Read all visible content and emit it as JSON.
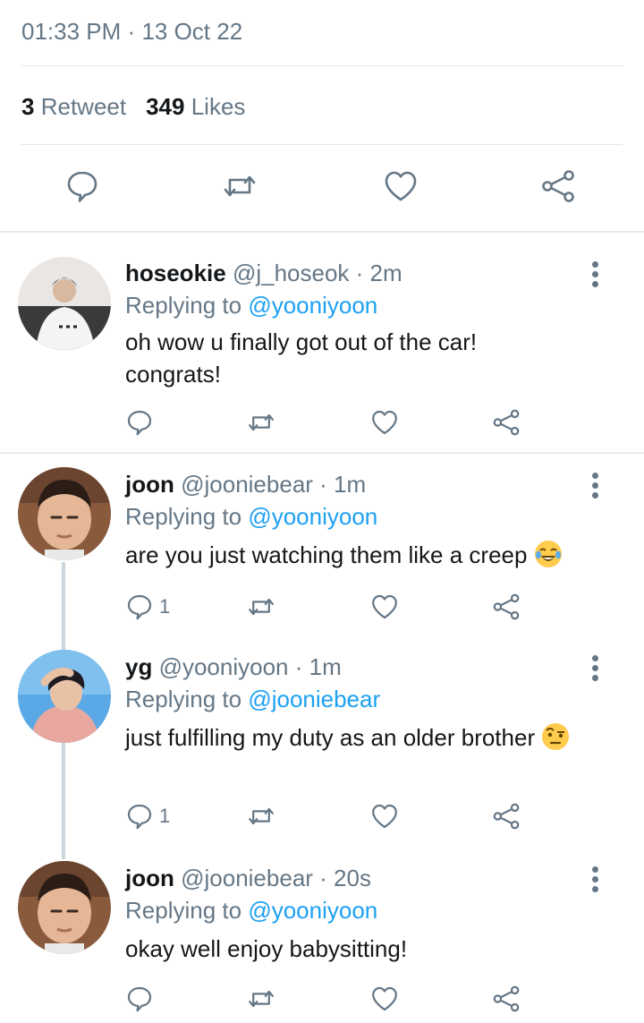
{
  "tweet": {
    "time": "01:33 PM",
    "separator": "·",
    "date": "13 Oct 22",
    "retweet_count": "3",
    "retweet_label": "Retweet",
    "like_count": "349",
    "like_label": "Likes"
  },
  "replies": [
    {
      "name": "hoseokie",
      "handle": "@j_hoseok",
      "age": "· 2m",
      "replying_label": "Replying to",
      "replying_to": "@yooniyoon",
      "text": "oh wow u finally got out of the car! congrats!",
      "reply_count": ""
    },
    {
      "name": "joon",
      "handle": "@jooniebear",
      "age": "· 1m",
      "replying_label": "Replying to",
      "replying_to": "@yooniyoon",
      "text": "are you just watching them like a creep",
      "reply_count": "1"
    },
    {
      "name": "yg",
      "handle": "@yooniyoon",
      "age": "· 1m",
      "replying_label": "Replying to",
      "replying_to": "@jooniebear",
      "text": "just fulfilling my duty as an older brother",
      "reply_count": "1"
    },
    {
      "name": "joon",
      "handle": "@jooniebear",
      "age": "· 20s",
      "replying_label": "Replying to",
      "replying_to": "@yooniyoon",
      "text": "okay well enjoy babysitting!",
      "reply_count": ""
    }
  ],
  "colors": {
    "accent": "#1da1f2",
    "muted": "#657786",
    "thread_line": "#ccd6dd"
  }
}
